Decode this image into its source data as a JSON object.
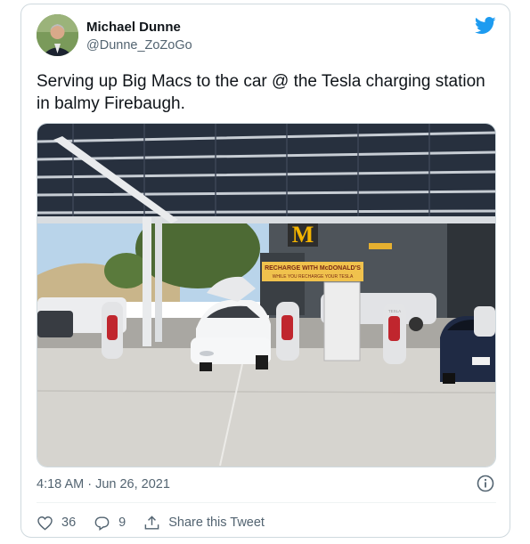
{
  "tweet": {
    "author_name": "Michael Dunne",
    "author_handle": "@Dunne_ZoZoGo",
    "text": "Serving up Big Macs to the car @ the Tesla charging station in balmy Firebaugh.",
    "timestamp": "4:18 AM · Jun 26, 2021"
  },
  "photo": {
    "banner_line1": "RECHARGE WITH McDONALD'S",
    "banner_line2": "WHILE YOU RECHARGE YOUR TESLA",
    "sign_text": "TESLA"
  },
  "actions": {
    "like_count": "36",
    "reply_count": "9",
    "share_label": "Share this Tweet"
  },
  "icons": {
    "bird": "twitter-bird-icon",
    "info": "info-icon",
    "like": "heart-icon",
    "reply": "reply-icon",
    "share": "share-icon"
  },
  "colors": {
    "brand": "#1d9bf0",
    "secondary_text": "#536471",
    "border": "#cfd9de"
  }
}
